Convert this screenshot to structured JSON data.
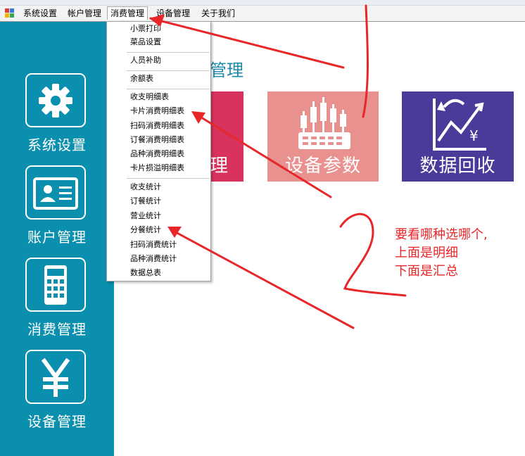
{
  "menubar": {
    "items": [
      "系统设置",
      "帐户管理",
      "消费管理",
      "设备管理",
      "关于我们"
    ]
  },
  "sidebar": {
    "items": [
      {
        "label": "系统设置",
        "icon": "gear-icon"
      },
      {
        "label": "账户管理",
        "icon": "id-card-icon"
      },
      {
        "label": "消费管理",
        "icon": "calculator-icon"
      },
      {
        "label": "设备管理",
        "icon": "yen-icon"
      }
    ]
  },
  "main": {
    "title_fragment": "管理",
    "cards": [
      {
        "label": "理",
        "color": "#d7335e",
        "icon": "terminal-icon"
      },
      {
        "label": "设备参数",
        "color": "#e9918e",
        "icon": "pos-terminal-icon"
      },
      {
        "label": "数据回收",
        "color": "#4b3a9a",
        "icon": "data-chart-icon"
      }
    ]
  },
  "dropdown": {
    "groups": [
      [
        "小票打印",
        "菜品设置"
      ],
      [
        "人员补助"
      ],
      [
        "余额表"
      ],
      [
        "收支明细表",
        "卡片消费明细表",
        "扫码消费明细表",
        "订餐消费明细表",
        "品种消费明细表",
        "卡片损溢明细表"
      ],
      [
        "收支统计",
        "订餐统计",
        "营业统计",
        "分餐统计",
        "扫码消费统计",
        "品种消费统计",
        "数据总表"
      ]
    ]
  },
  "annotation": {
    "lines": [
      "要看哪种选哪个,",
      "上面是明细",
      "下面是汇总"
    ],
    "color": "#e8272a"
  }
}
